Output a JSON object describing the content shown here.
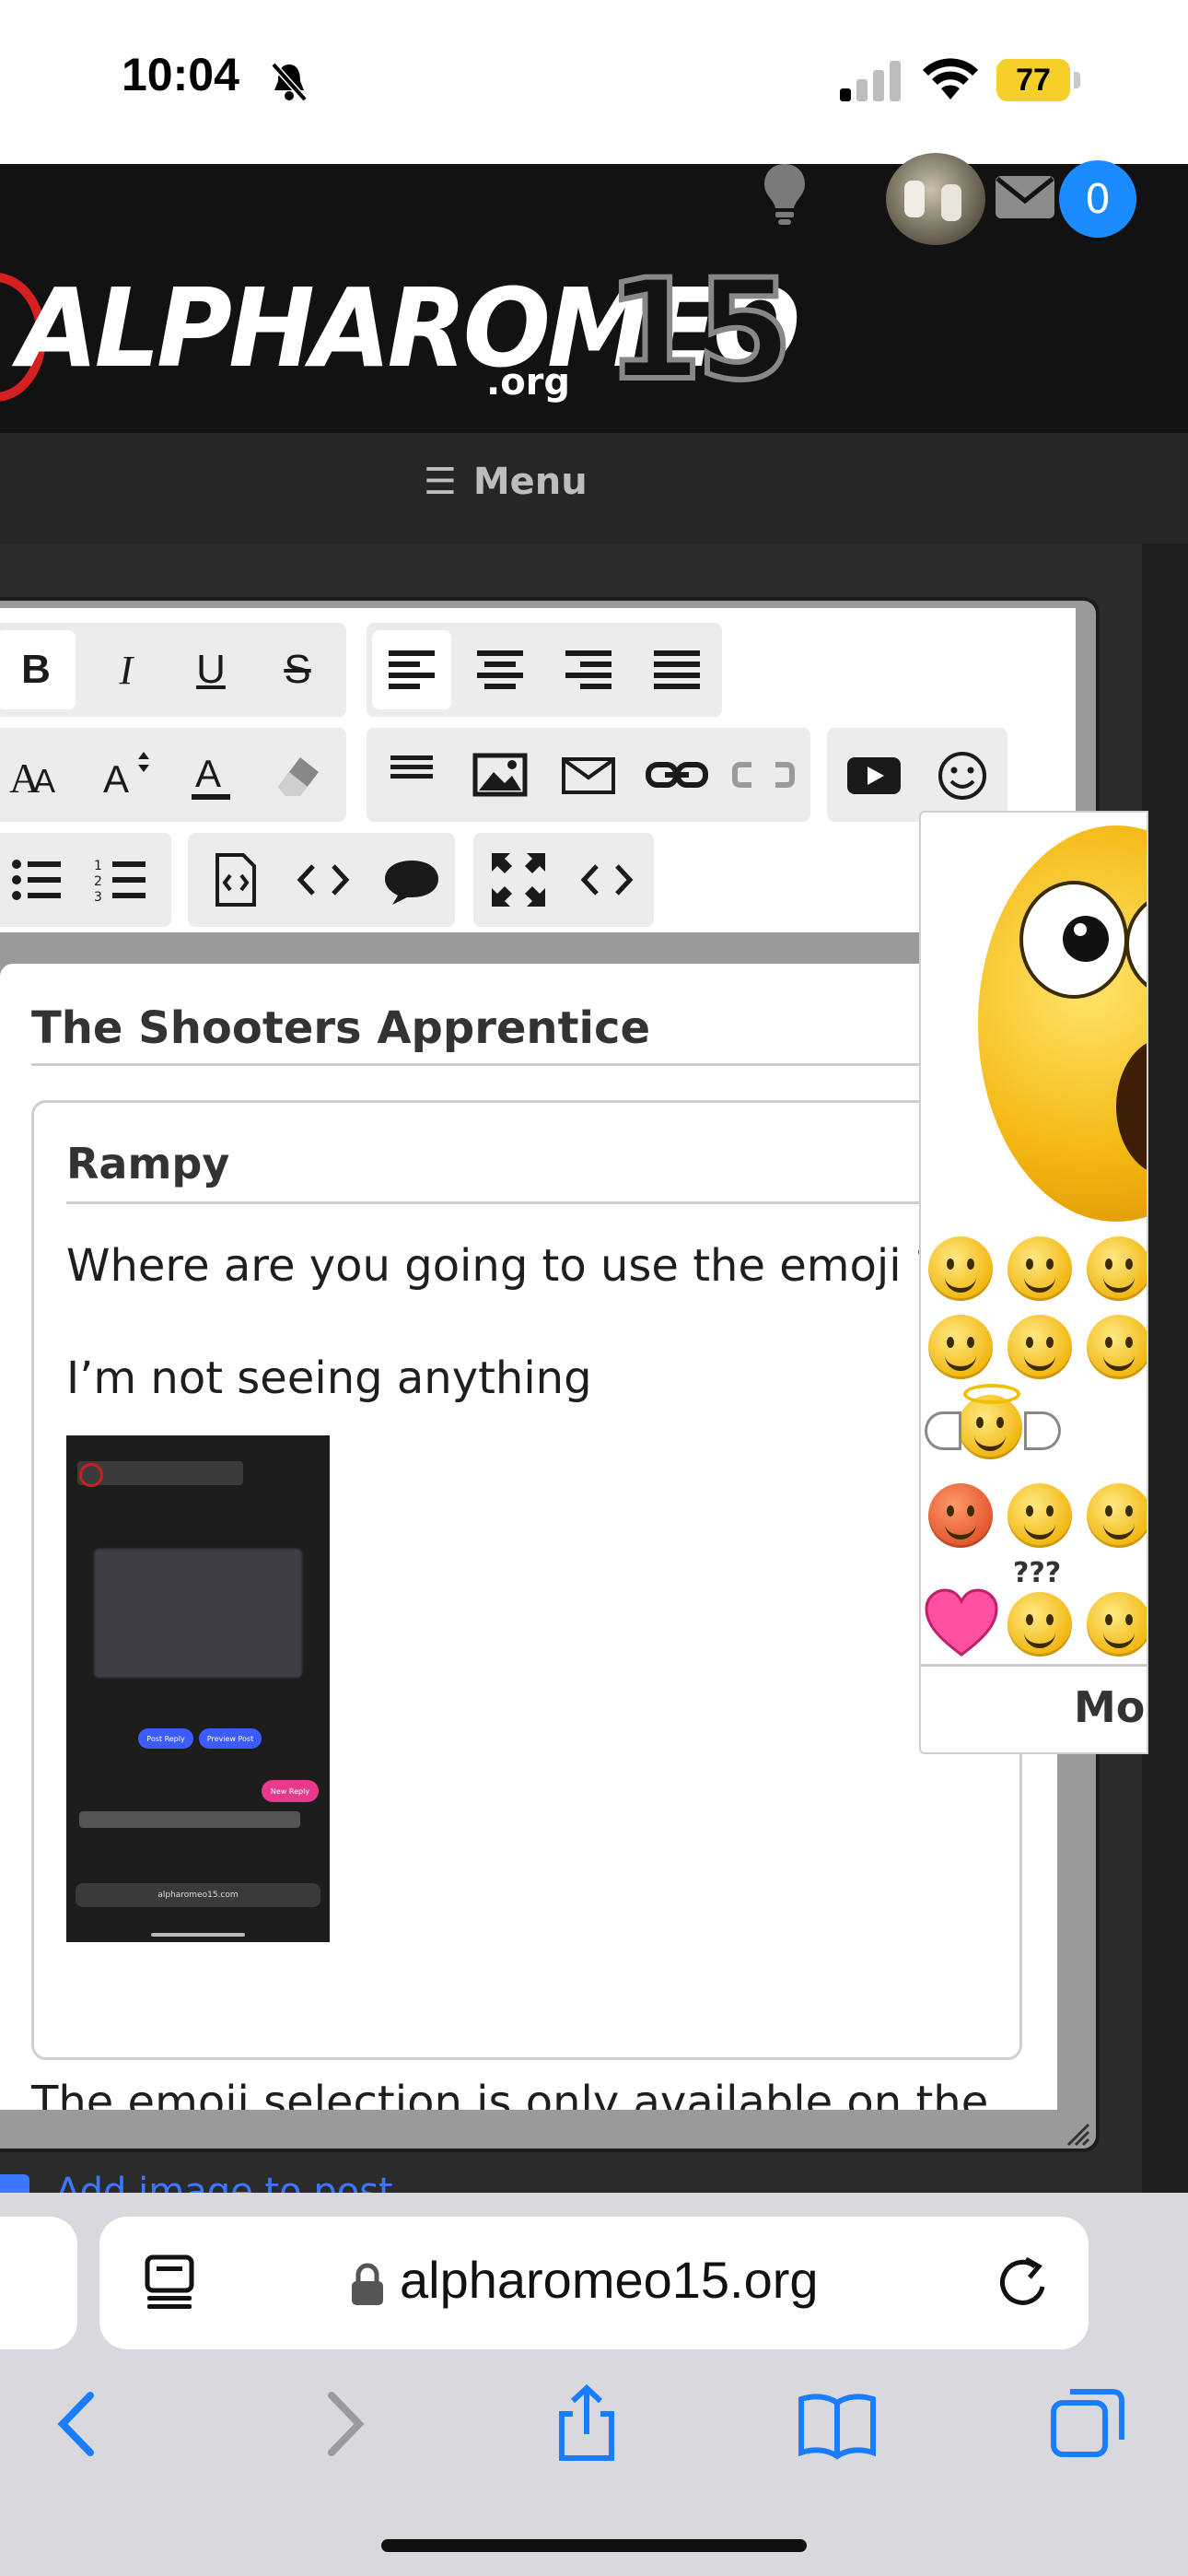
{
  "status_bar": {
    "time": "10:04",
    "battery": "77"
  },
  "site": {
    "logo_text": "ALPHAROMEO",
    "logo_number": "15",
    "logo_suffix": ".org",
    "notification_count": "0",
    "menu_label": "Menu"
  },
  "toolbar": {
    "bold": "B",
    "italic": "I",
    "underline": "U",
    "strike": "S"
  },
  "editor": {
    "title": "The Shooters Apprentice",
    "quote_user": "Rampy",
    "quote_line1": "Where are you going to use the emoji ???",
    "quote_line2": "I’m not seeing anything",
    "thumb_url": "alpharomeo15.com",
    "thumb_post_reply": "Post Reply",
    "thumb_preview_post": "Preview Post",
    "thumb_new_reply": "New Reply",
    "bottom_text": "The emoji selection is only available on the",
    "add_image": "Add image to post"
  },
  "emoji_popup": {
    "question_marks": "???",
    "more_label": "More"
  },
  "browser": {
    "url": "alpharomeo15.org"
  },
  "colors": {
    "accent_blue": "#1a8cff",
    "battery_yellow": "#f5cf2a",
    "link_blue": "#3a78ff"
  }
}
